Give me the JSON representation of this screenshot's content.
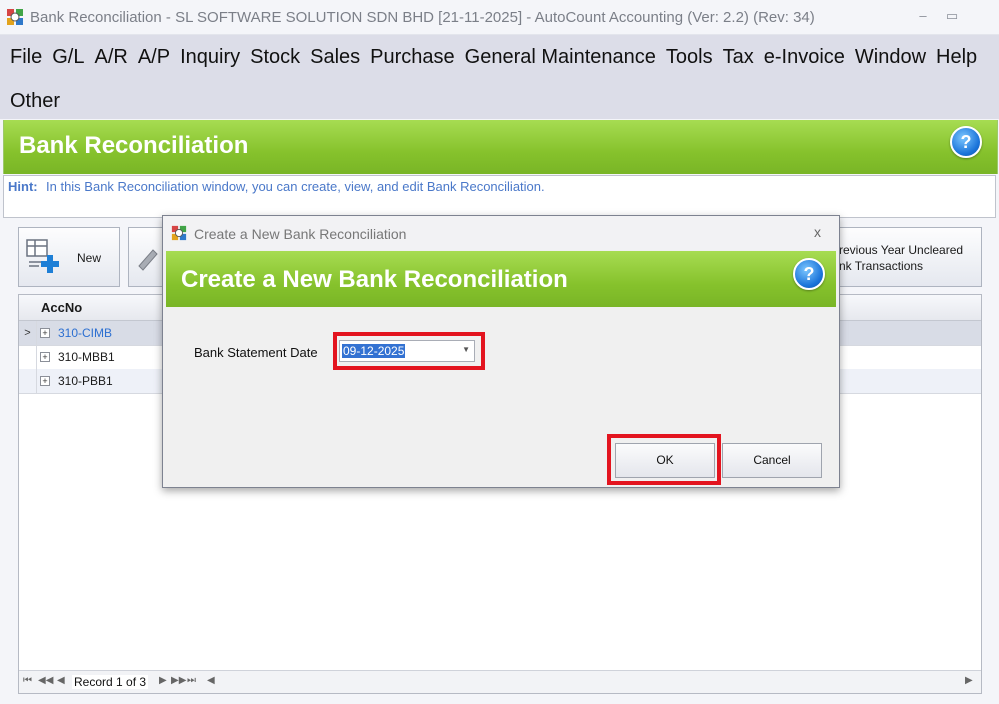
{
  "window": {
    "title": "Bank Reconciliation - SL SOFTWARE SOLUTION SDN BHD [21-11-2025] - AutoCount Accounting (Ver: 2.2) (Rev: 34)",
    "minimize_glyph": "–",
    "maximize_glyph": "▭"
  },
  "menubar": {
    "row1": [
      "File",
      "G/L",
      "A/R",
      "A/P",
      "Inquiry",
      "Stock",
      "Sales",
      "Purchase",
      "General Maintenance",
      "Tools",
      "Tax",
      "e-Invoice",
      "Window",
      "Help"
    ],
    "row2": [
      "Other"
    ]
  },
  "header": {
    "title": "Bank Reconciliation",
    "help_glyph": "?"
  },
  "hint": {
    "label": "Hint:",
    "text": "In this Bank Reconciliation window, you can create, view, and edit Bank Reconciliation."
  },
  "toolbar": {
    "new_label": "New",
    "prev_year_line1": "revious Year Uncleared",
    "prev_year_line2": "nk Transactions"
  },
  "grid": {
    "column_header": "AccNo",
    "rows": [
      {
        "acc": "310-CIMB",
        "selected": true
      },
      {
        "acc": "310-MBB1",
        "selected": false
      },
      {
        "acc": "310-PBB1",
        "selected": false
      }
    ],
    "record_text": "Record 1 of 3",
    "row_indicator_glyph": ">",
    "expander_glyph": "+"
  },
  "dialog": {
    "title": "Create a New Bank Reconciliation",
    "header_title": "Create a New Bank Reconciliation",
    "close_glyph": "x",
    "help_glyph": "?",
    "field_label": "Bank Statement Date",
    "date_value": "09-12-2025",
    "dropdown_glyph": "▼",
    "ok_label": "OK",
    "cancel_label": "Cancel"
  },
  "colors": {
    "header_green": "#86c22c",
    "highlight_red": "#e3141f",
    "hint_blue": "#4a78c9",
    "selection_blue": "#3372d2"
  }
}
